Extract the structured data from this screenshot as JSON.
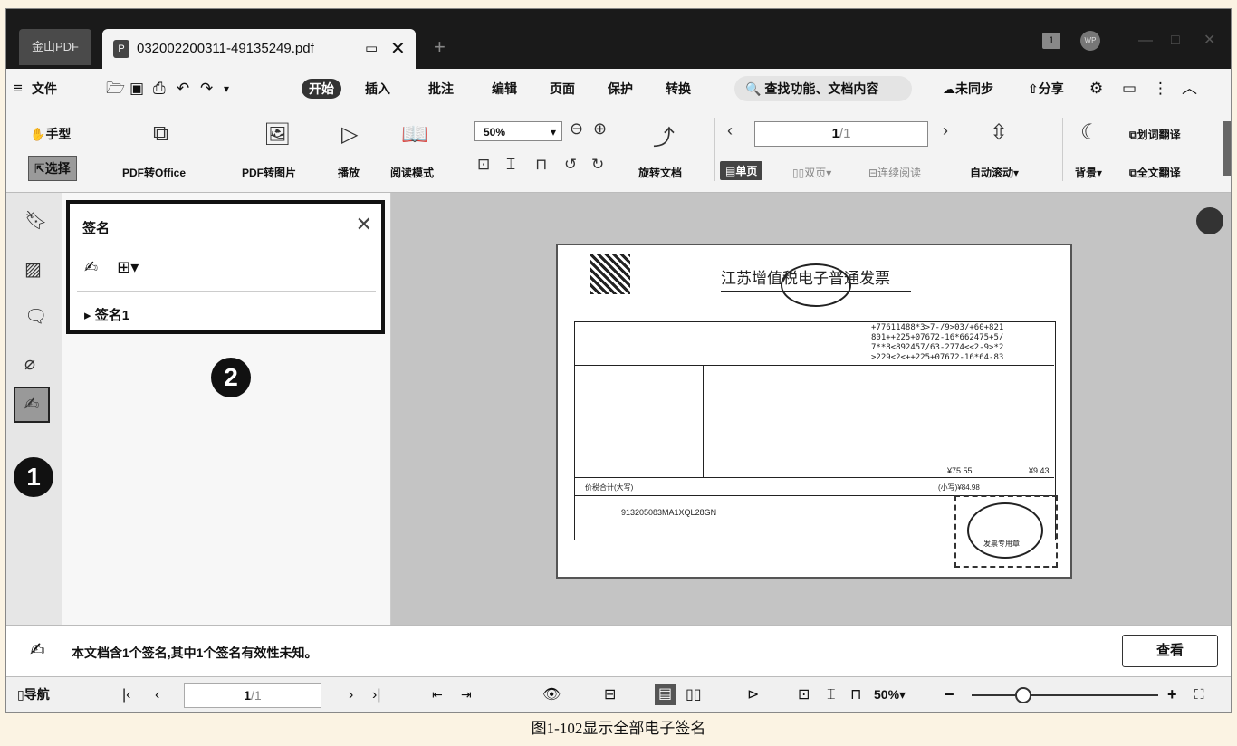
{
  "tabbar": {
    "app_tab": "金山PDF",
    "doc_tab": "032002200311-49135249.pdf",
    "new_tab": "+",
    "badge": "1",
    "avatar": "WP"
  },
  "menubar": {
    "file": "文件",
    "items": [
      "开始",
      "插入",
      "批注",
      "编辑",
      "页面",
      "保护",
      "转换"
    ],
    "search_placeholder": "查找功能、文档内容",
    "sync": "未同步",
    "share": "分享"
  },
  "ribbon": {
    "hand": "手型",
    "select": "选择",
    "pdf_to_office": "PDF转Office",
    "pdf_to_image": "PDF转图片",
    "play": "播放",
    "read_mode": "阅读模式",
    "zoom": "50%",
    "rotate_doc": "旋转文档",
    "page_current": "1",
    "page_total": "/1",
    "single_page": "单页",
    "double_page": "双页",
    "continuous": "连续阅读",
    "auto_scroll": "自动滚动",
    "background": "背景",
    "word_translate": "划词翻译",
    "full_translate": "全文翻译"
  },
  "signature_panel": {
    "title": "签名",
    "item": "签名1",
    "callout_1": "1",
    "callout_2": "2"
  },
  "invoice": {
    "title": "江苏增值税电子普通发票",
    "total_words": "价税合计(大写)",
    "total_small": "(小写)¥84.98",
    "subtotal_1": "¥75.55",
    "subtotal_2": "¥9.43",
    "cipher": "+77611488*3>7-/9>03/+60+821 801++225+07672-16*662475+5/ 7**8<892457/63-2774<<2-9>*2 >229<2<++225+07672-16*64-83",
    "seller_tax_id": "913205083MA1XQL28GN",
    "stamp": "发票专用章"
  },
  "status": {
    "message": "本文档含1个签名,其中1个签名有效性未知。",
    "view_button": "查看"
  },
  "bottombar": {
    "nav": "导航",
    "page_current": "1",
    "page_total": "/1",
    "zoom": "50%"
  },
  "caption": "图1-102显示全部电子签名"
}
